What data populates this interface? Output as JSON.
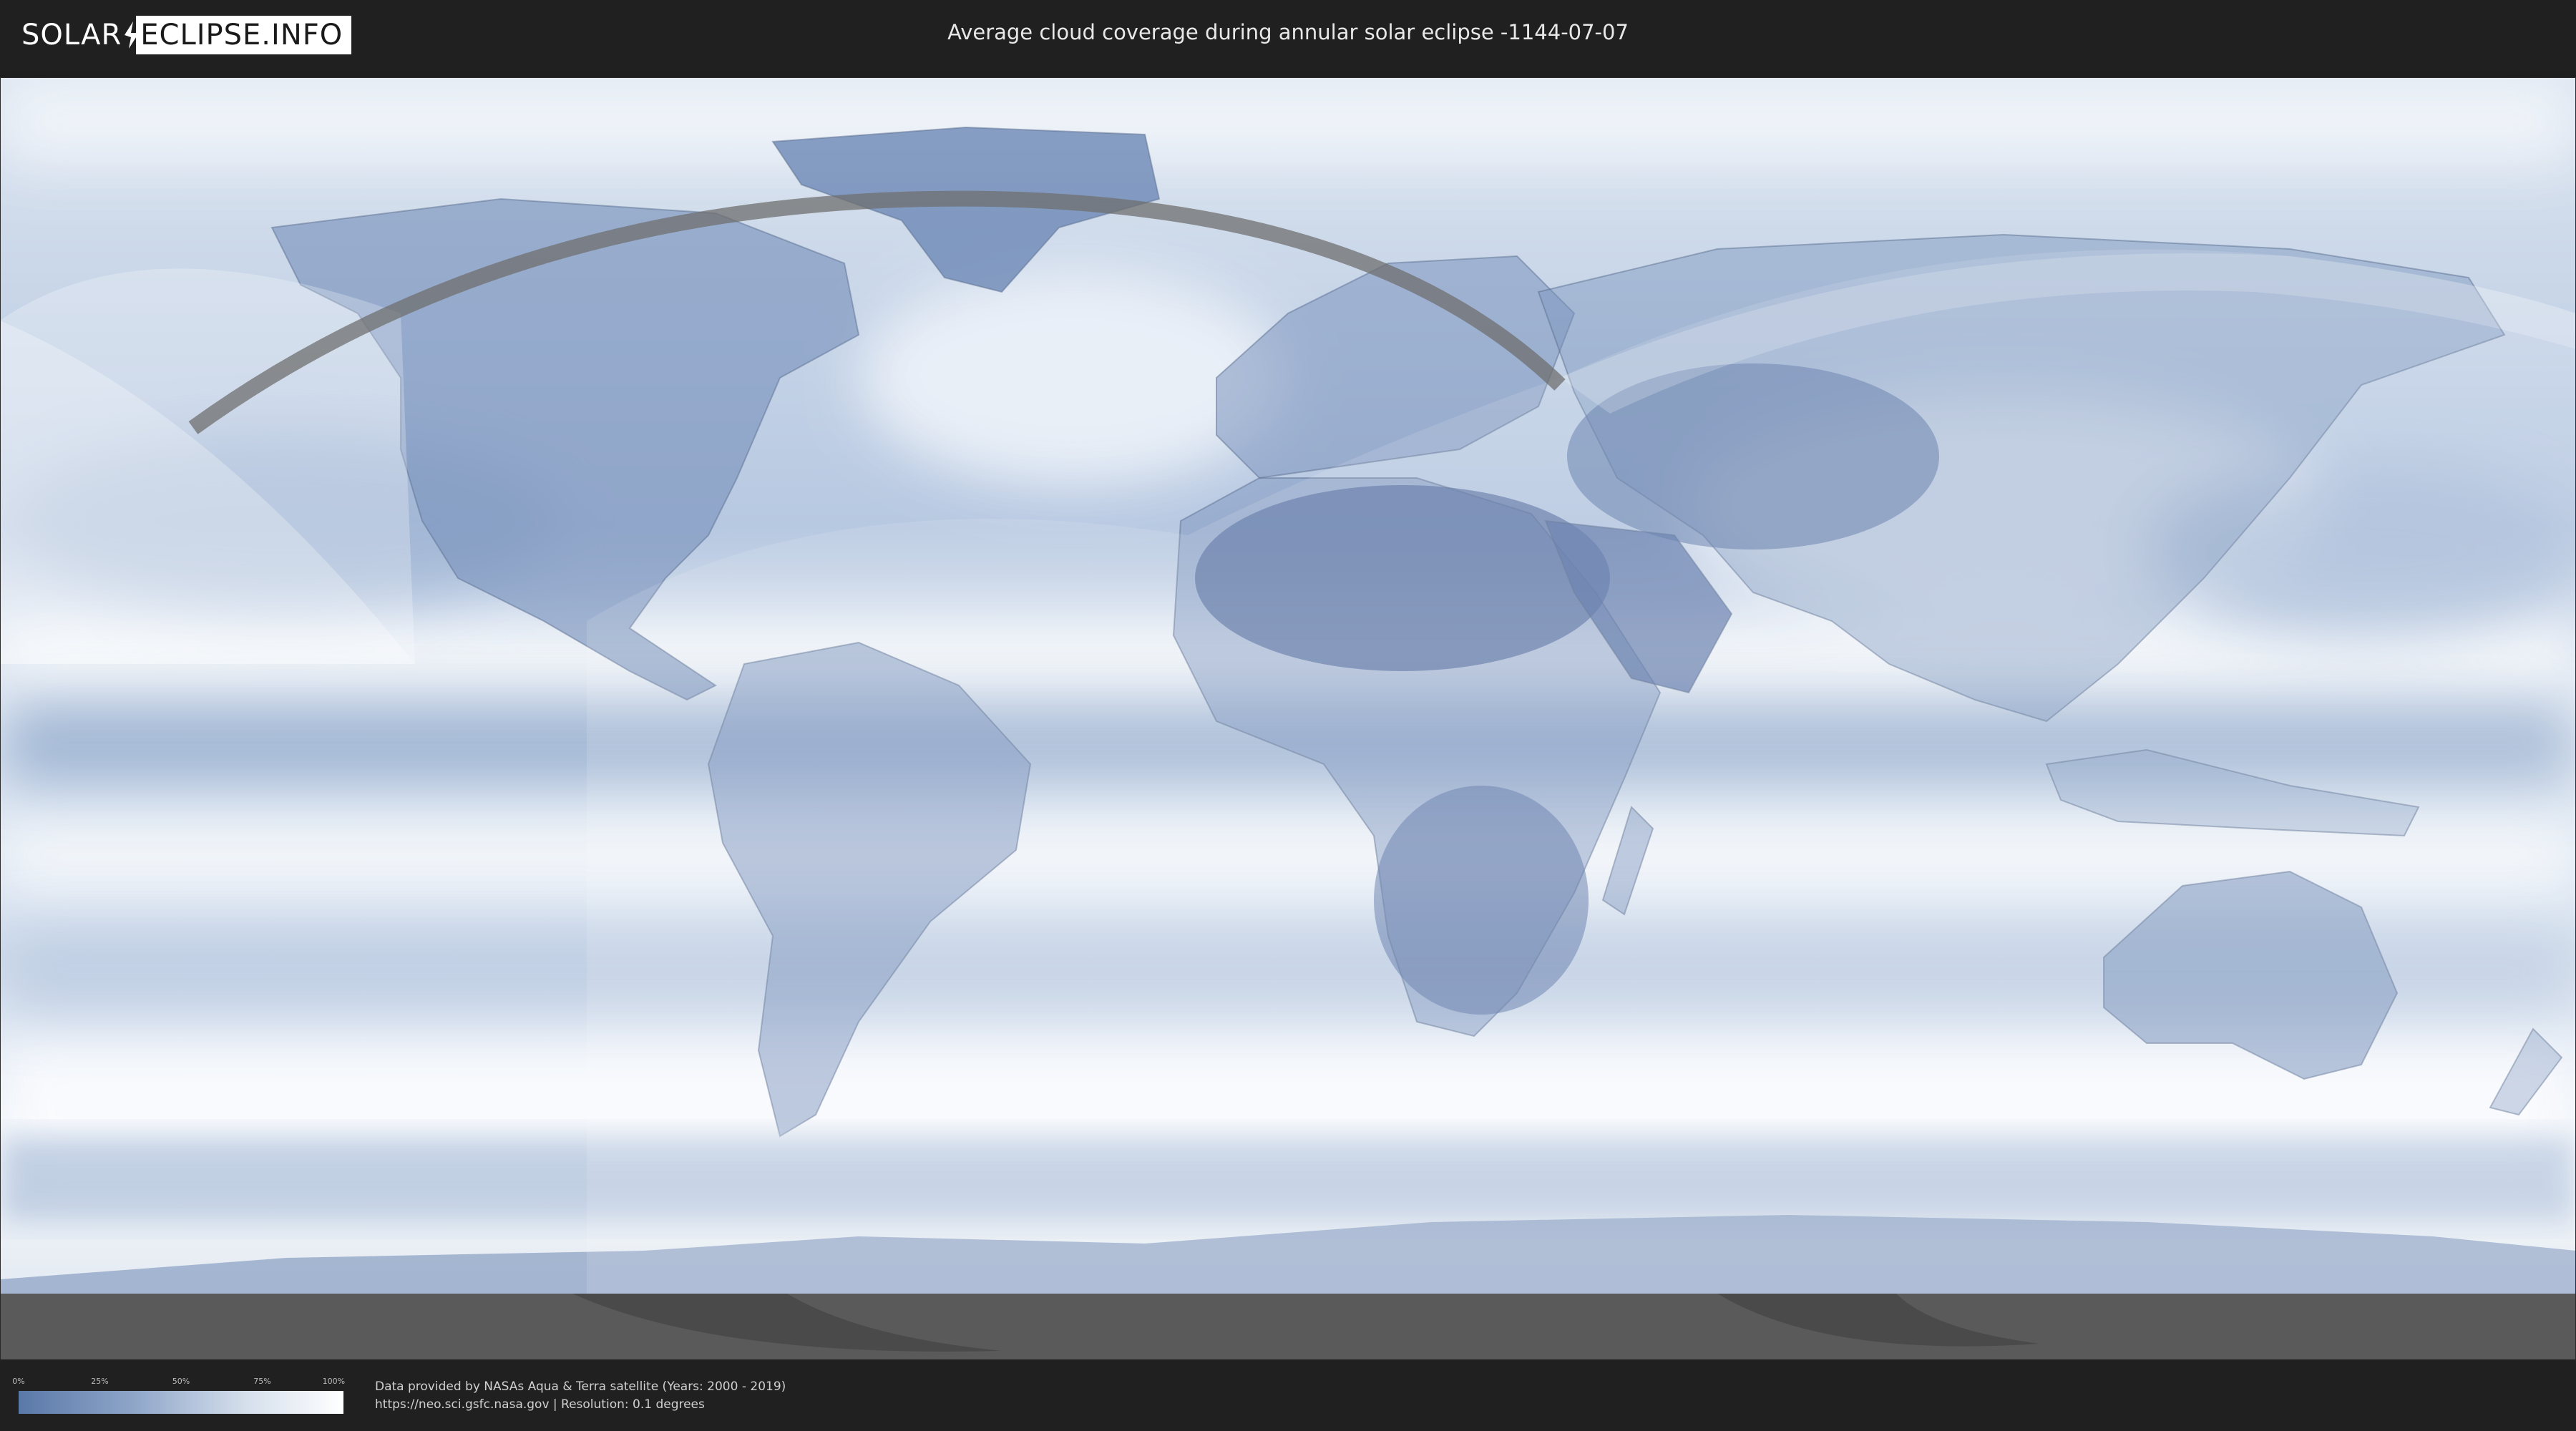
{
  "header": {
    "logo_part1": "SOLAR",
    "logo_part2": "ECLIPSE.INFO",
    "title": "Average cloud coverage during annular solar eclipse -1144-07-07"
  },
  "map": {
    "base": "world-equirectangular-cloud-cover",
    "colors": {
      "clear": "#4f6fa3",
      "mid": "#a9bddb",
      "cloudy": "#ffffff",
      "eclipse_path": "#707070",
      "visibility_overlay": "#ffffff",
      "antarctic_shadow": "#5a5a5a"
    }
  },
  "legend": {
    "ticks": [
      "0%",
      "25%",
      "50%",
      "75%",
      "100%"
    ],
    "values": [
      0,
      25,
      50,
      75,
      100
    ]
  },
  "credits": {
    "line1": "Data provided by NASAs Aqua & Terra satellite (Years: 2000 - 2019)",
    "line2": "https://neo.sci.gsfc.nasa.gov | Resolution: 0.1 degrees"
  }
}
